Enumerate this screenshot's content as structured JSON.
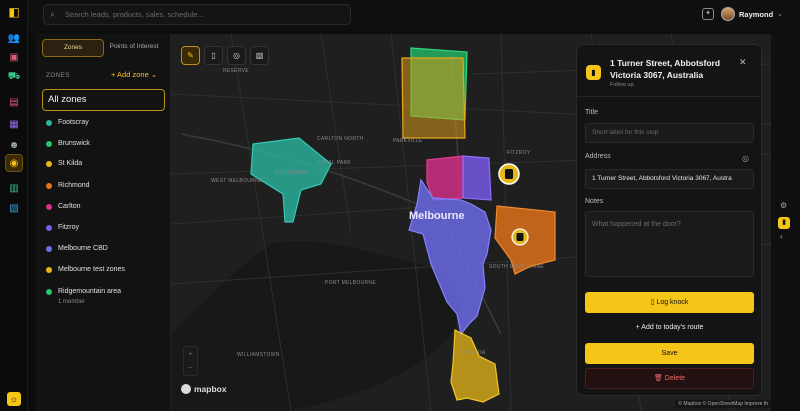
{
  "colors": {
    "accent": "#f5c518",
    "background": "#0d0d0d",
    "danger": "#ef6b6b"
  },
  "topbar": {
    "search_placeholder": "Search leads, products, sales, schedule...",
    "user_name": "Raymond"
  },
  "rail_icons": [
    "users-icon",
    "box-icon",
    "truck-icon",
    "book-icon",
    "store-icon",
    "team-icon",
    "map-pin-icon",
    "calendar-icon",
    "map-icon"
  ],
  "zones_panel": {
    "tabs": [
      {
        "label": "Zones",
        "active": true
      },
      {
        "label": "Points of Interest",
        "active": false
      }
    ],
    "section_label": "ZONES",
    "add_zone_label": "+ Add zone",
    "all_zones_label": "All zones",
    "zones": [
      {
        "name": "Footscray",
        "color": "#2bb5a0"
      },
      {
        "name": "Brunswick",
        "color": "#27c46b"
      },
      {
        "name": "St Kilda",
        "color": "#e8b81a"
      },
      {
        "name": "Richmond",
        "color": "#e8741a"
      },
      {
        "name": "Carlton",
        "color": "#d9308a"
      },
      {
        "name": "Fitzroy",
        "color": "#7c5cf0"
      },
      {
        "name": "Melbourne CBD",
        "color": "#6e6ef0"
      },
      {
        "name": "Melbourne test zones",
        "color": "#e8b81a"
      },
      {
        "name": "Ridgemountain area",
        "color": "#27c46b",
        "sub": "1 member"
      }
    ]
  },
  "map": {
    "city_label": "Melbourne",
    "brand": "mapbox",
    "attribution": "© Mapbox © OpenStreetMap  Improve th",
    "tools": [
      "pin-draw-icon",
      "phone-icon",
      "location-icon",
      "map-fold-icon"
    ],
    "labels": [
      "RESERVE",
      "PARKVILLE",
      "WEST MELBOURNE",
      "FOOTSCRAY",
      "FITZROY",
      "WILLIAMSTOWN",
      "ST KILDA",
      "PORT MELBOURNE",
      "SOUTH MELBOURNE",
      "CARLTON NORTH",
      "ROYAL PARK"
    ]
  },
  "detail": {
    "address_title": "1 Turner Street, Abbotsford Victoria 3067, Australia",
    "status": "Follow up",
    "title_label": "Title",
    "title_placeholder": "Short label for this stop",
    "address_label": "Address",
    "address_value": "1 Turner Street, Abbotsford Victoria 3067, Austra",
    "notes_label": "Notes",
    "notes_placeholder": "What happened at the door?",
    "log_knock_label": "Log knock",
    "add_route_label": "Add to today's route",
    "save_label": "Save",
    "delete_label": "Delete"
  }
}
